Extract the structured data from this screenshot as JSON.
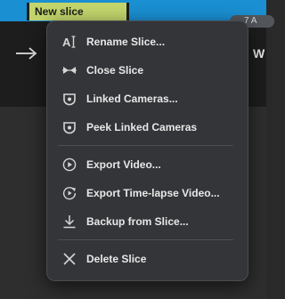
{
  "timeline": {
    "slice_label": "New slice",
    "time_label": "7 A"
  },
  "background": {
    "right_text": "W"
  },
  "context_menu": {
    "items": [
      {
        "label": "Rename Slice...",
        "icon": "rename-icon"
      },
      {
        "label": "Close Slice",
        "icon": "close-slice-icon"
      },
      {
        "label": "Linked Cameras...",
        "icon": "camera-icon"
      },
      {
        "label": "Peek Linked Cameras",
        "icon": "camera-icon"
      },
      {
        "label": "Export Video...",
        "icon": "play-circle-icon"
      },
      {
        "label": "Export Time-lapse Video...",
        "icon": "timelapse-icon"
      },
      {
        "label": "Backup from Slice...",
        "icon": "download-icon"
      },
      {
        "label": "Delete Slice",
        "icon": "x-icon"
      }
    ]
  },
  "colors": {
    "timeline_blue": "#1a8fd1",
    "slice_green": "#c3d66c",
    "menu_bg": "#333538"
  }
}
